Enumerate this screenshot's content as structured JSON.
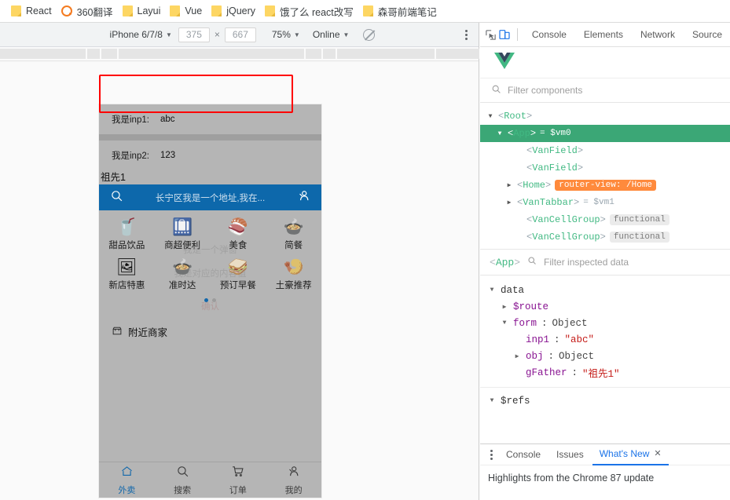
{
  "bookmarks": [
    {
      "label": "React",
      "icon": "folder-icon"
    },
    {
      "label": "360翻译",
      "icon": "360-circle-icon"
    },
    {
      "label": "Layui",
      "icon": "folder-icon"
    },
    {
      "label": "Vue",
      "icon": "folder-icon"
    },
    {
      "label": "jQuery",
      "icon": "folder-icon"
    },
    {
      "label": "饿了么 react改写",
      "icon": "folder-icon"
    },
    {
      "label": "森哥前端笔记",
      "icon": "folder-icon"
    }
  ],
  "device_toolbar": {
    "device": "iPhone 6/7/8",
    "width": "375",
    "height": "667",
    "times": "×",
    "zoom": "75%",
    "throttling": "Online",
    "caret": "▼",
    "no_cache_icon": "no-throttling-icon",
    "more_icon": "more-vertical-icon"
  },
  "mobile": {
    "fields": [
      {
        "label": "我是inp1:",
        "value": "abc"
      },
      {
        "label": "我是inp2:",
        "value": "123"
      }
    ],
    "gfather": "祖先1",
    "search": {
      "placeholder": "长宁区我是一个地址,我在...",
      "search_icon": "search-icon",
      "user_icon": "user-icon",
      "bg": "#0d68ab"
    },
    "categories": [
      {
        "label": "甜品饮品",
        "emoji": "🥤"
      },
      {
        "label": "商超便利",
        "emoji": "🛄"
      },
      {
        "label": "美食",
        "emoji": "🍣"
      },
      {
        "label": "简餐",
        "emoji": "🍲"
      },
      {
        "label": "新店特惠",
        "emoji": "🖼"
      },
      {
        "label": "准时达",
        "emoji": "🍲"
      },
      {
        "label": "预订早餐",
        "emoji": "🥪"
      },
      {
        "label": "土豪推荐",
        "emoji": "🍤"
      }
    ],
    "ghost_dialog": {
      "title": "我是一个弹窗",
      "body": "我是对应的内容值",
      "confirm": "确认"
    },
    "nearby": {
      "label": "附近商家",
      "icon": "shop-icon"
    },
    "tabbar": [
      {
        "label": "外卖",
        "icon": "home-icon",
        "active": true
      },
      {
        "label": "搜索",
        "icon": "search-icon",
        "active": false
      },
      {
        "label": "订单",
        "icon": "cart-icon",
        "active": false
      },
      {
        "label": "我的",
        "icon": "user-icon",
        "active": false
      }
    ],
    "accent": "#1268ab"
  },
  "devtools": {
    "toolbar_icons": [
      {
        "name": "inspect-element-icon"
      },
      {
        "name": "toggle-device-toolbar-icon",
        "active": true
      }
    ],
    "tabs": [
      "Console",
      "Elements",
      "Network",
      "Source"
    ],
    "logo": "vue-logo-icon",
    "filter_components_placeholder": "Filter components",
    "tree": [
      {
        "indent": 0,
        "arrow": "▼",
        "tag": "Root",
        "selected": false
      },
      {
        "indent": 1,
        "arrow": "▼",
        "tag": "App",
        "vm": "= $vm0",
        "selected": true
      },
      {
        "indent": 2,
        "arrow": "",
        "tag": "VanField",
        "selected": false
      },
      {
        "indent": 2,
        "arrow": "",
        "tag": "VanField",
        "selected": false
      },
      {
        "indent": 2,
        "arrow": "▶",
        "tag": "Home",
        "badge": "router-view: /Home",
        "badge_kind": "router",
        "selected": false
      },
      {
        "indent": 2,
        "arrow": "▶",
        "tag": "VanTabbar",
        "vm": "= $vm1",
        "selected": false
      },
      {
        "indent": 2,
        "arrow": "",
        "tag": "VanCellGroup",
        "badge": "functional",
        "badge_kind": "fn",
        "selected": false
      },
      {
        "indent": 2,
        "arrow": "",
        "tag": "VanCellGroup",
        "badge": "functional",
        "badge_kind": "fn",
        "selected": false
      }
    ],
    "inspected": {
      "component": "App",
      "filter_placeholder": "Filter inspected data",
      "rows": [
        {
          "indent": 0,
          "caret": "▼",
          "key": "data",
          "kind": "group"
        },
        {
          "indent": 1,
          "caret": "▶",
          "key": "$route",
          "kind": "group"
        },
        {
          "indent": 1,
          "caret": "▼",
          "key": "form",
          "sep": ":",
          "type": "Object",
          "kind": "obj"
        },
        {
          "indent": 2,
          "caret": "",
          "key": "inp1",
          "sep": ":",
          "value": "\"abc\"",
          "kind": "str",
          "highlight": true
        },
        {
          "indent": 2,
          "caret": "▶",
          "key": "obj",
          "sep": ":",
          "type": "Object",
          "kind": "obj"
        },
        {
          "indent": 2,
          "caret": "",
          "key": "gFather",
          "sep": ":",
          "value": "\"祖先1\"",
          "kind": "str"
        },
        {
          "indent": 0,
          "caret": "▼",
          "key": "$refs",
          "kind": "group",
          "divider": true
        }
      ]
    },
    "drawer": {
      "tabs": [
        {
          "label": "Console",
          "active": false
        },
        {
          "label": "Issues",
          "active": false
        },
        {
          "label": "What's New",
          "active": true,
          "close": "✕"
        }
      ],
      "body": "Highlights from the Chrome 87 update",
      "more_icon": "more-vertical-icon"
    }
  }
}
